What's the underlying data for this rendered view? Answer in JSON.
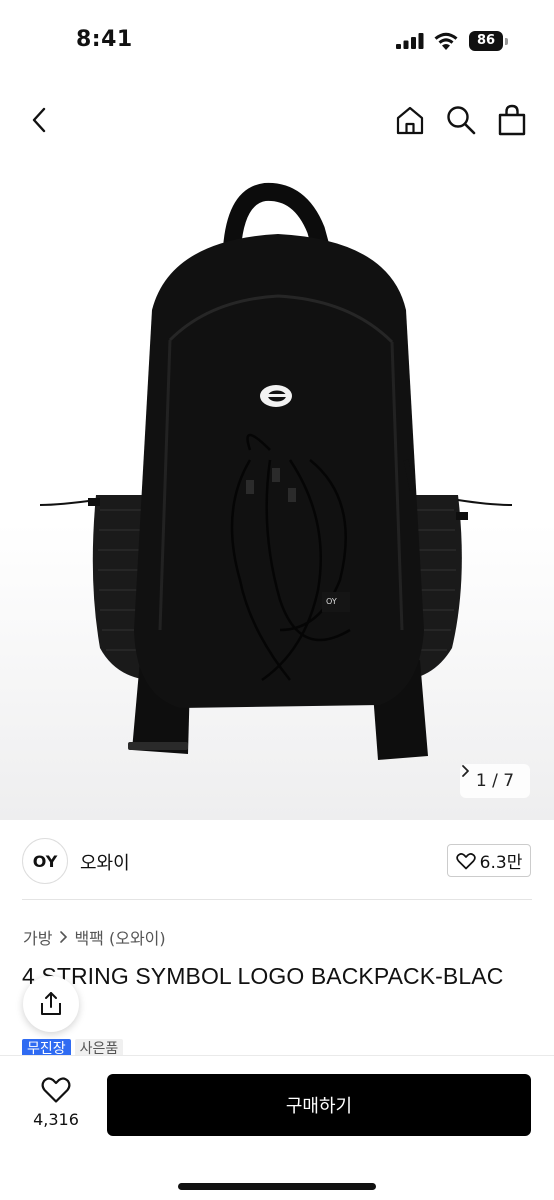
{
  "status_bar": {
    "time": "8:41",
    "battery": "86",
    "icons": [
      "cellular-signal-icon",
      "wifi-icon",
      "battery-icon"
    ]
  },
  "nav": {
    "icons": [
      "chevron-left-icon",
      "home-icon",
      "search-icon",
      "shopping-bag-icon"
    ]
  },
  "gallery": {
    "pager": "1 / 7",
    "image_alt": "black backpack product photo"
  },
  "brand": {
    "logo_text": "OY",
    "name": "오와이",
    "likes": "6.3만"
  },
  "breadcrumb": [
    "가방",
    "백팩 (오와이)"
  ],
  "product": {
    "title": "4 STRING SYMBOL LOGO BACKPACK-BLAC",
    "badges": [
      "무진장",
      "사은품"
    ]
  },
  "bottom_bar": {
    "wish_count": "4,316",
    "buy_label": "구매하기"
  },
  "colors": {
    "badge_blue": "#2f6bf2",
    "buy_button": "#000000"
  }
}
